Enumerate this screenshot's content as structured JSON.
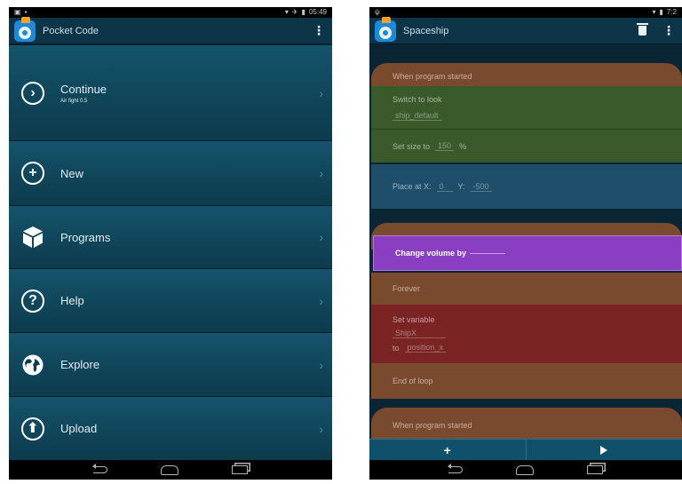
{
  "left": {
    "status": {
      "time": "05:49"
    },
    "title": "Pocket Code",
    "overflow": "⋮",
    "menu": [
      {
        "label": "Continue",
        "sub": "Air fight 0.5",
        "icon": "continue-icon"
      },
      {
        "label": "New",
        "icon": "plus-circle-icon"
      },
      {
        "label": "Programs",
        "icon": "cube-icon"
      },
      {
        "label": "Help",
        "icon": "help-icon"
      },
      {
        "label": "Explore",
        "icon": "globe-icon"
      },
      {
        "label": "Upload",
        "icon": "upload-icon"
      }
    ],
    "chevron": "›"
  },
  "right": {
    "status": {
      "time": "7:2"
    },
    "title": "Spaceship",
    "overflow": "⋮",
    "bricks": {
      "when1": "When program started",
      "switch_label": "Switch to look",
      "switch_value": "ship_default",
      "size_label": "Set size to",
      "size_value": "150",
      "size_unit": "%",
      "place_label": "Place at X:",
      "place_x": "0",
      "place_y_label": "Y:",
      "place_y": "-500",
      "volume_label": "Change volume by",
      "forever": "Forever",
      "setvar_label": "Set variable",
      "setvar_name": "ShipX",
      "setvar_to": "to",
      "setvar_value": "position_x",
      "endloop": "End of loop",
      "when2": "When program started"
    },
    "bottom": {
      "add": "+"
    }
  },
  "colors": {
    "event": "#7a4a2e",
    "looks": "#3a5a2c",
    "motion": "#1f4e6a",
    "sound": "#8a3fc2",
    "control": "#7a4a2e",
    "data": "#7a2424"
  }
}
